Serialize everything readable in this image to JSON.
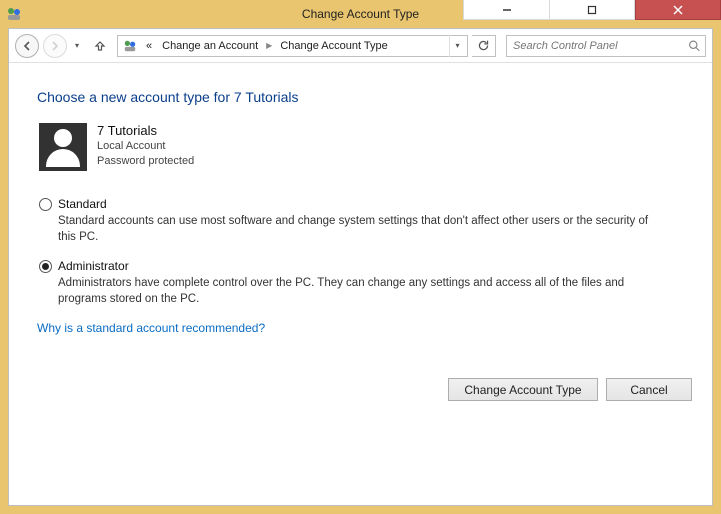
{
  "window": {
    "title": "Change Account Type"
  },
  "breadcrumb": {
    "level1": "Change an Account",
    "level2": "Change Account Type"
  },
  "search": {
    "placeholder": "Search Control Panel"
  },
  "heading": "Choose a new account type for 7 Tutorials",
  "user": {
    "name": "7 Tutorials",
    "type": "Local Account",
    "protection": "Password protected"
  },
  "options": {
    "standard": {
      "label": "Standard",
      "desc": "Standard accounts can use most software and change system settings that don't affect other users or the security of this PC.",
      "selected": false
    },
    "administrator": {
      "label": "Administrator",
      "desc": "Administrators have complete control over the PC. They can change any settings and access all of the files and programs stored on the PC.",
      "selected": true
    }
  },
  "help_link": "Why is a standard account recommended?",
  "buttons": {
    "primary": "Change Account Type",
    "cancel": "Cancel"
  }
}
